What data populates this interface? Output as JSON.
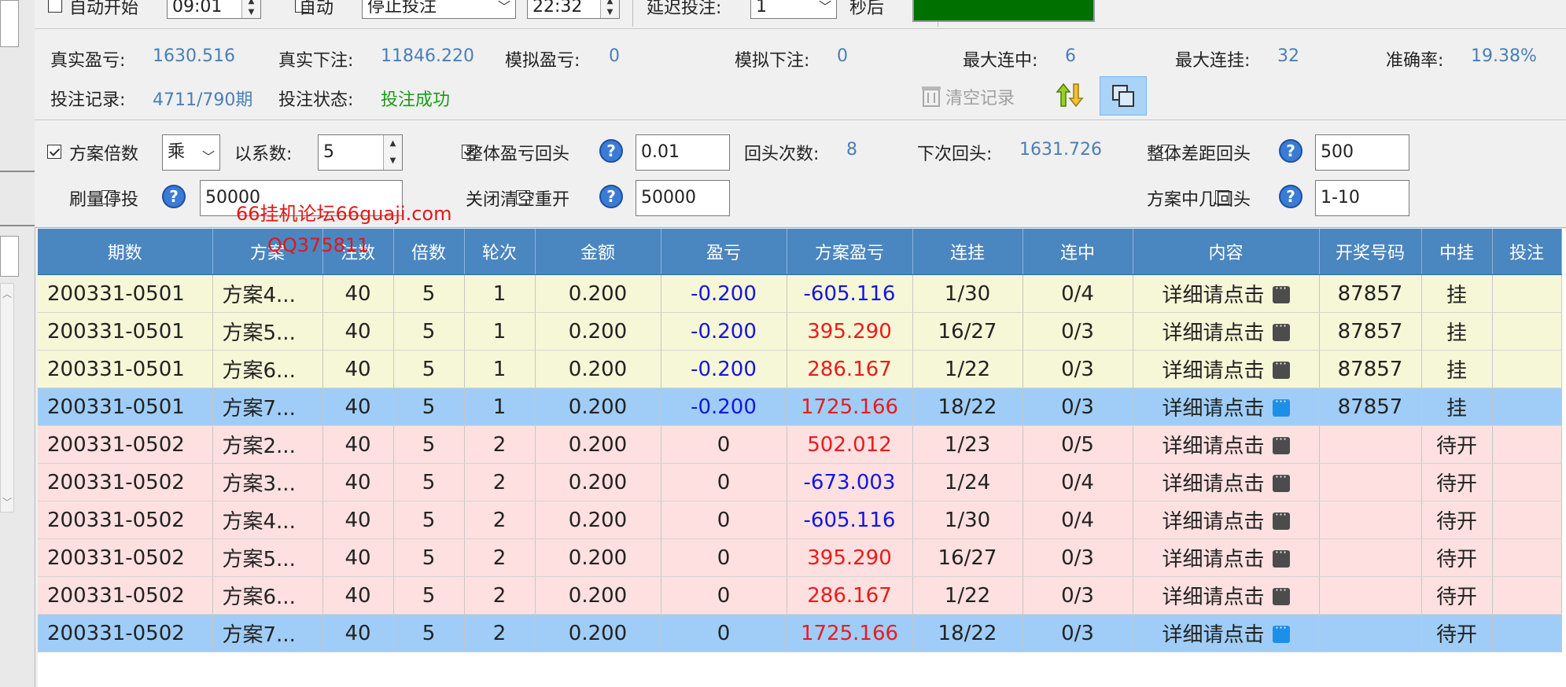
{
  "top": {
    "auto_start_label": "自动开始",
    "auto_start_time": "09:01",
    "auto_label": "自动",
    "auto_action": "停止投注",
    "auto_time": "22:32",
    "delay_label": "延迟投注:",
    "delay_value": "1",
    "delay_unit": "秒后"
  },
  "stats": {
    "real_profit_label": "真实盈亏:",
    "real_profit": "1630.516",
    "real_bet_label": "真实下注:",
    "real_bet": "11846.220",
    "sim_profit_label": "模拟盈亏:",
    "sim_profit": "0",
    "sim_bet_label": "模拟下注:",
    "sim_bet": "0",
    "max_win_label": "最大连中:",
    "max_win": "6",
    "max_loss_label": "最大连挂:",
    "max_loss": "32",
    "accuracy_label": "准确率:",
    "accuracy": "19.38%",
    "bet_record_label": "投注记录:",
    "bet_record": "4711/790期",
    "bet_status_label": "投注状态:",
    "bet_status": "投注成功",
    "clear_record_label": "清空记录"
  },
  "settings": {
    "plan_multiplier_label": "方案倍数",
    "plan_multiplier_op": "乘",
    "coef_label": "以系数:",
    "coef_value": "5",
    "overall_profit_label": "整体盈亏回头",
    "overall_profit_value": "0.01",
    "return_count_label": "回头次数:",
    "return_count": "8",
    "next_return_label": "下次回头:",
    "next_return": "1631.726",
    "overall_gap_label": "整体差距回头",
    "overall_gap_value": "500",
    "stop_label": "刷量停投",
    "stop_value": "50000",
    "close_label": "关闭清空重开",
    "close_value": "50000",
    "plan_hit_label": "方案中几回头",
    "plan_hit_value": "1-10"
  },
  "watermark": {
    "line1": "66挂机论坛66guaji.com",
    "line2": "QQ375811"
  },
  "table": {
    "headers": [
      "期数",
      "方案",
      "注数",
      "倍数",
      "轮次",
      "金额",
      "盈亏",
      "方案盈亏",
      "连挂",
      "连中",
      "内容",
      "开奖号码",
      "中挂",
      "投注"
    ],
    "rows": [
      {
        "period": "200331-0501",
        "plan": "方案4...",
        "notes": "40",
        "mult": "5",
        "round": "1",
        "amount": "0.200",
        "profit": "-0.200",
        "plan_profit": "-605.116",
        "loss_streak": "1/30",
        "win_streak": "0/4",
        "content": "详细请点击",
        "draw": "87857",
        "status": "挂",
        "bet": "",
        "style": "yellow",
        "profit_sign": "neg",
        "plan_sign": "neg"
      },
      {
        "period": "200331-0501",
        "plan": "方案5...",
        "notes": "40",
        "mult": "5",
        "round": "1",
        "amount": "0.200",
        "profit": "-0.200",
        "plan_profit": "395.290",
        "loss_streak": "16/27",
        "win_streak": "0/3",
        "content": "详细请点击",
        "draw": "87857",
        "status": "挂",
        "bet": "",
        "style": "yellow",
        "profit_sign": "neg",
        "plan_sign": "pos"
      },
      {
        "period": "200331-0501",
        "plan": "方案6...",
        "notes": "40",
        "mult": "5",
        "round": "1",
        "amount": "0.200",
        "profit": "-0.200",
        "plan_profit": "286.167",
        "loss_streak": "1/22",
        "win_streak": "0/3",
        "content": "详细请点击",
        "draw": "87857",
        "status": "挂",
        "bet": "",
        "style": "yellow",
        "profit_sign": "neg",
        "plan_sign": "pos"
      },
      {
        "period": "200331-0501",
        "plan": "方案7...",
        "notes": "40",
        "mult": "5",
        "round": "1",
        "amount": "0.200",
        "profit": "-0.200",
        "plan_profit": "1725.166",
        "loss_streak": "18/22",
        "win_streak": "0/3",
        "content": "详细请点击",
        "draw": "87857",
        "status": "挂",
        "bet": "",
        "style": "sel",
        "profit_sign": "neg",
        "plan_sign": "pos"
      },
      {
        "period": "200331-0502",
        "plan": "方案2...",
        "notes": "40",
        "mult": "5",
        "round": "2",
        "amount": "0.200",
        "profit": "0",
        "plan_profit": "502.012",
        "loss_streak": "1/23",
        "win_streak": "0/5",
        "content": "详细请点击",
        "draw": "",
        "status": "待开",
        "bet": "",
        "style": "pink",
        "profit_sign": "zero",
        "plan_sign": "pos"
      },
      {
        "period": "200331-0502",
        "plan": "方案3...",
        "notes": "40",
        "mult": "5",
        "round": "2",
        "amount": "0.200",
        "profit": "0",
        "plan_profit": "-673.003",
        "loss_streak": "1/24",
        "win_streak": "0/4",
        "content": "详细请点击",
        "draw": "",
        "status": "待开",
        "bet": "",
        "style": "pink",
        "profit_sign": "zero",
        "plan_sign": "neg"
      },
      {
        "period": "200331-0502",
        "plan": "方案4...",
        "notes": "40",
        "mult": "5",
        "round": "2",
        "amount": "0.200",
        "profit": "0",
        "plan_profit": "-605.116",
        "loss_streak": "1/30",
        "win_streak": "0/4",
        "content": "详细请点击",
        "draw": "",
        "status": "待开",
        "bet": "",
        "style": "pink",
        "profit_sign": "zero",
        "plan_sign": "neg"
      },
      {
        "period": "200331-0502",
        "plan": "方案5...",
        "notes": "40",
        "mult": "5",
        "round": "2",
        "amount": "0.200",
        "profit": "0",
        "plan_profit": "395.290",
        "loss_streak": "16/27",
        "win_streak": "0/3",
        "content": "详细请点击",
        "draw": "",
        "status": "待开",
        "bet": "",
        "style": "pink",
        "profit_sign": "zero",
        "plan_sign": "pos"
      },
      {
        "period": "200331-0502",
        "plan": "方案6...",
        "notes": "40",
        "mult": "5",
        "round": "2",
        "amount": "0.200",
        "profit": "0",
        "plan_profit": "286.167",
        "loss_streak": "1/22",
        "win_streak": "0/3",
        "content": "详细请点击",
        "draw": "",
        "status": "待开",
        "bet": "",
        "style": "pink",
        "profit_sign": "zero",
        "plan_sign": "pos"
      },
      {
        "period": "200331-0502",
        "plan": "方案7...",
        "notes": "40",
        "mult": "5",
        "round": "2",
        "amount": "0.200",
        "profit": "0",
        "plan_profit": "1725.166",
        "loss_streak": "18/22",
        "win_streak": "0/3",
        "content": "详细请点击",
        "draw": "",
        "status": "待开",
        "bet": "",
        "style": "sel",
        "profit_sign": "zero",
        "plan_sign": "pos"
      }
    ]
  },
  "colors": {
    "header_bg": "#4a86c0",
    "row_yellow": "#f6f7d6",
    "row_pink": "#fde0df",
    "row_selected": "#9fcdf7",
    "negative": "#1515e0",
    "positive": "#e81c1c",
    "value_blue": "#4a7fb5",
    "status_green": "#1a9a1a",
    "indicator_green": "#007000"
  },
  "icons": {
    "help": "question-mark-circle-icon",
    "clear": "trash-icon",
    "sort": "up-down-arrows-icon",
    "copy": "window-copy-icon",
    "detail": "ellipsis-button-icon"
  }
}
